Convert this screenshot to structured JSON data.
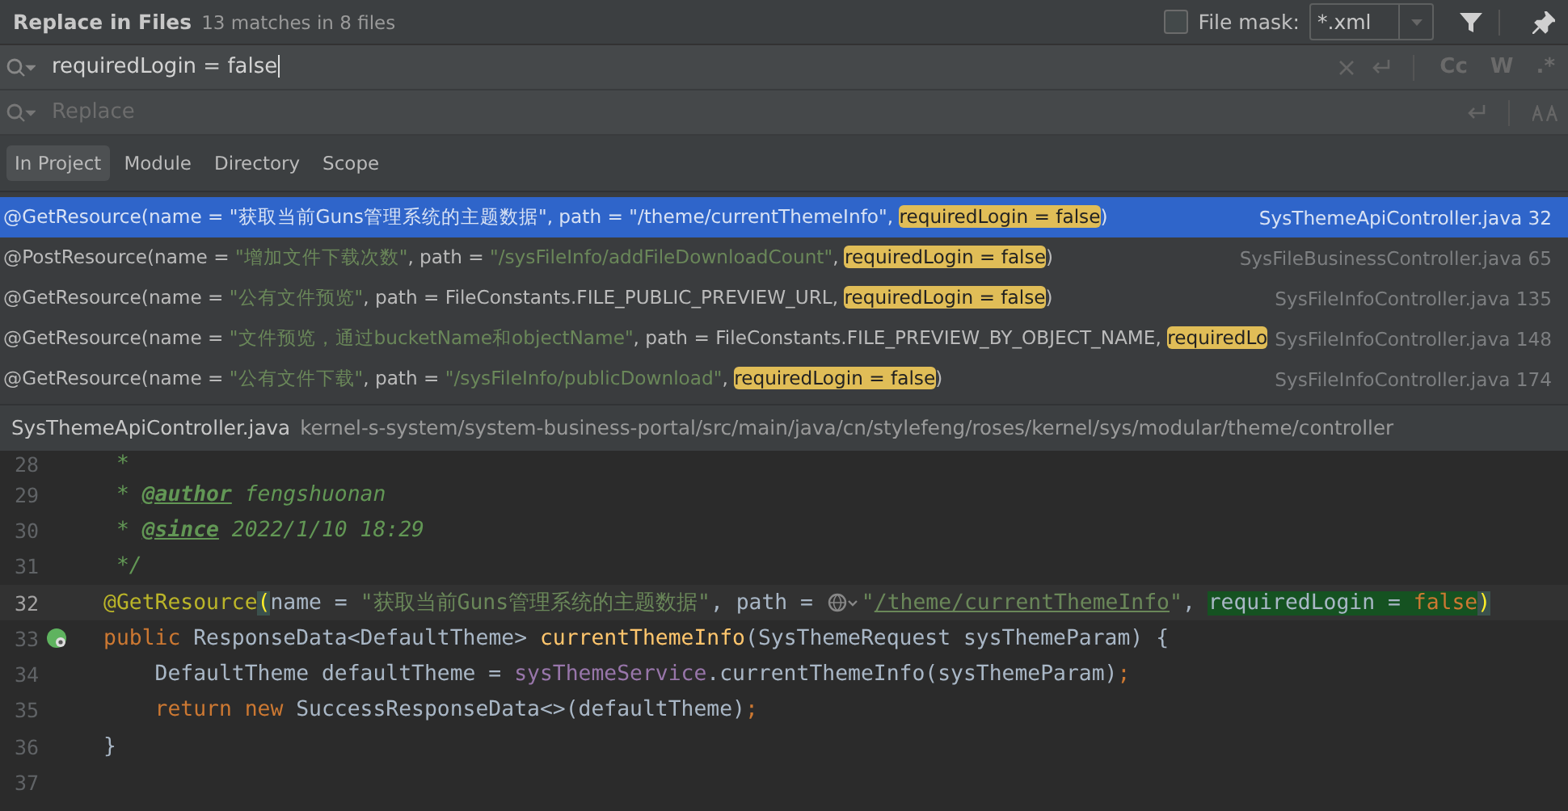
{
  "header": {
    "title": "Replace in Files",
    "summary": "13 matches in 8 files",
    "file_mask": {
      "checked": false,
      "label": "File mask:",
      "value": "*.xml"
    }
  },
  "search": {
    "value": "requiredLogin = false",
    "options": [
      "Cc",
      "W",
      ".*"
    ]
  },
  "replace": {
    "placeholder": "Replace"
  },
  "scopes": [
    {
      "label": "In Project",
      "selected": true
    },
    {
      "label": "Module",
      "selected": false
    },
    {
      "label": "Directory",
      "selected": false
    },
    {
      "label": "Scope",
      "selected": false
    }
  ],
  "results": [
    {
      "selected": true,
      "segments": [
        {
          "kind": "plain",
          "text": "@GetResource(name = "
        },
        {
          "kind": "string",
          "text": "\"获取当前Guns管理系统的主题数据\""
        },
        {
          "kind": "plain",
          "text": ", path = "
        },
        {
          "kind": "string",
          "text": "\"/theme/currentThemeInfo\""
        },
        {
          "kind": "plain",
          "text": ", "
        },
        {
          "kind": "match",
          "text": "requiredLogin = false"
        },
        {
          "kind": "plain",
          "text": ")"
        }
      ],
      "file": "SysThemeApiController.java",
      "line": "32"
    },
    {
      "selected": false,
      "segments": [
        {
          "kind": "plain",
          "text": "@PostResource(name = "
        },
        {
          "kind": "string",
          "text": "\"增加文件下载次数\""
        },
        {
          "kind": "plain",
          "text": ", path = "
        },
        {
          "kind": "string",
          "text": "\"/sysFileInfo/addFileDownloadCount\""
        },
        {
          "kind": "plain",
          "text": ", "
        },
        {
          "kind": "match",
          "text": "requiredLogin = false"
        },
        {
          "kind": "plain",
          "text": ")"
        }
      ],
      "file": "SysFileBusinessController.java",
      "line": "65"
    },
    {
      "selected": false,
      "segments": [
        {
          "kind": "plain",
          "text": "@GetResource(name = "
        },
        {
          "kind": "string",
          "text": "\"公有文件预览\""
        },
        {
          "kind": "plain",
          "text": ", path = FileConstants.FILE_PUBLIC_PREVIEW_URL, "
        },
        {
          "kind": "match",
          "text": "requiredLogin = false"
        },
        {
          "kind": "plain",
          "text": ")"
        }
      ],
      "file": "SysFileInfoController.java",
      "line": "135"
    },
    {
      "selected": false,
      "segments": [
        {
          "kind": "plain",
          "text": "@GetResource(name = "
        },
        {
          "kind": "string",
          "text": "\"文件预览，通过bucketName和objectName\""
        },
        {
          "kind": "plain",
          "text": ", path = FileConstants.FILE_PREVIEW_BY_OBJECT_NAME, "
        },
        {
          "kind": "match",
          "text": "requiredLo"
        }
      ],
      "file": "SysFileInfoController.java",
      "line": "148"
    },
    {
      "selected": false,
      "segments": [
        {
          "kind": "plain",
          "text": "@GetResource(name = "
        },
        {
          "kind": "string",
          "text": "\"公有文件下载\""
        },
        {
          "kind": "plain",
          "text": ", path = "
        },
        {
          "kind": "string",
          "text": "\"/sysFileInfo/publicDownload\""
        },
        {
          "kind": "plain",
          "text": ", "
        },
        {
          "kind": "match",
          "text": "requiredLogin = false"
        },
        {
          "kind": "plain",
          "text": ")"
        }
      ],
      "file": "SysFileInfoController.java",
      "line": "174"
    }
  ],
  "file_bar": {
    "file": "SysThemeApiController.java",
    "path": "kernel-s-system/system-business-portal/src/main/java/cn/stylefeng/roses/kernel/sys/modular/theme/controller"
  },
  "editor": {
    "lines": [
      {
        "number": "28",
        "current": false,
        "tokens": [
          {
            "kind": "comment",
            "text": " *"
          }
        ]
      },
      {
        "number": "29",
        "current": false,
        "tokens": [
          {
            "kind": "comment",
            "text": " * "
          },
          {
            "kind": "doctag",
            "text": "@author"
          },
          {
            "kind": "comment",
            "text": " fengshuonan"
          }
        ]
      },
      {
        "number": "30",
        "current": false,
        "tokens": [
          {
            "kind": "comment",
            "text": " * "
          },
          {
            "kind": "doctag",
            "text": "@since"
          },
          {
            "kind": "comment",
            "text": " 2022/1/10 18:29"
          }
        ]
      },
      {
        "number": "31",
        "current": false,
        "tokens": [
          {
            "kind": "comment",
            "text": " */"
          }
        ]
      },
      {
        "number": "32",
        "current": true,
        "tokens": [
          {
            "kind": "annotation",
            "text": "@GetResource"
          },
          {
            "kind": "brace",
            "text": "("
          },
          {
            "kind": "plain",
            "text": "name = "
          },
          {
            "kind": "string",
            "text": "\"获取当前Guns管理系统的主题数据\""
          },
          {
            "kind": "plain",
            "text": ", path = "
          },
          {
            "kind": "globe"
          },
          {
            "kind": "string",
            "text": "\""
          },
          {
            "kind": "link",
            "text": "/theme/currentThemeInfo"
          },
          {
            "kind": "string",
            "text": "\""
          },
          {
            "kind": "plain",
            "text": ", "
          },
          {
            "kind": "hl",
            "text": "requiredLogin = "
          },
          {
            "kind": "hlkw",
            "text": "false"
          },
          {
            "kind": "brace",
            "text": ")"
          }
        ]
      },
      {
        "number": "33",
        "current": false,
        "run_marker": true,
        "tokens": [
          {
            "kind": "keyword",
            "text": "public "
          },
          {
            "kind": "plain",
            "text": "ResponseData<DefaultTheme> "
          },
          {
            "kind": "method",
            "text": "currentThemeInfo"
          },
          {
            "kind": "plain",
            "text": "(SysThemeRequest sysThemeParam) {"
          }
        ]
      },
      {
        "number": "34",
        "current": false,
        "tokens": [
          {
            "kind": "plain",
            "text": "    DefaultTheme defaultTheme = "
          },
          {
            "kind": "field",
            "text": "sysThemeService"
          },
          {
            "kind": "plain",
            "text": ".currentThemeInfo(sysThemeParam)"
          },
          {
            "kind": "keyword",
            "text": ";"
          }
        ]
      },
      {
        "number": "35",
        "current": false,
        "tokens": [
          {
            "kind": "keyword",
            "text": "    return new "
          },
          {
            "kind": "plain",
            "text": "SuccessResponseData<>(defaultTheme)"
          },
          {
            "kind": "keyword",
            "text": ";"
          }
        ]
      },
      {
        "number": "36",
        "current": false,
        "tokens": [
          {
            "kind": "plain",
            "text": "}"
          }
        ]
      },
      {
        "number": "37",
        "current": false
      }
    ]
  }
}
